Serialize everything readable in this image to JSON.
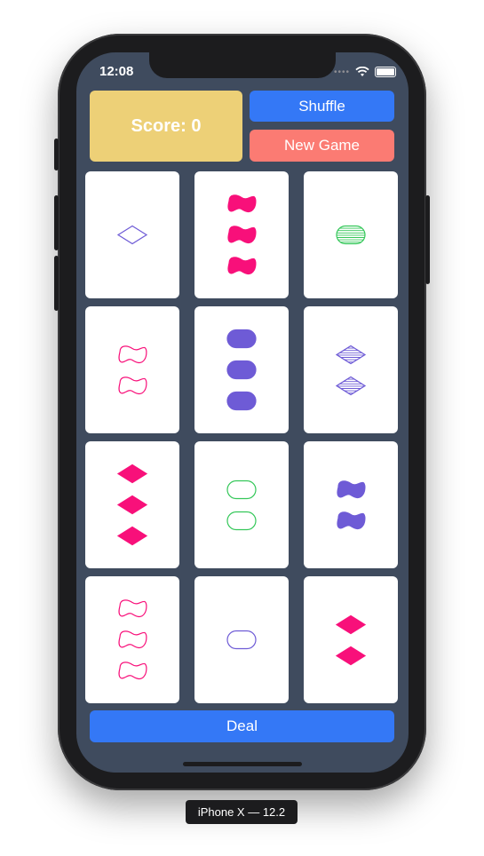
{
  "status_bar": {
    "time": "12:08"
  },
  "header": {
    "score_label": "Score: 0",
    "shuffle_label": "Shuffle",
    "new_game_label": "New Game"
  },
  "footer": {
    "deal_label": "Deal"
  },
  "device_caption": "iPhone X — 12.2",
  "colors": {
    "purple": "#6e5bd6",
    "pink": "#f8107a",
    "green": "#34c759",
    "blue_button": "#3478f6",
    "salmon_button": "#fb7b73",
    "score_yellow": "#edd077",
    "table": "#3f4b5e"
  },
  "cards": [
    {
      "count": 1,
      "shape": "diamond",
      "color": "purple",
      "shading": "open"
    },
    {
      "count": 3,
      "shape": "squiggle",
      "color": "pink",
      "shading": "solid"
    },
    {
      "count": 1,
      "shape": "oval",
      "color": "green",
      "shading": "striped"
    },
    {
      "count": 2,
      "shape": "squiggle",
      "color": "pink",
      "shading": "open"
    },
    {
      "count": 3,
      "shape": "oval",
      "color": "purple",
      "shading": "solid"
    },
    {
      "count": 2,
      "shape": "diamond",
      "color": "purple",
      "shading": "striped"
    },
    {
      "count": 3,
      "shape": "diamond",
      "color": "pink",
      "shading": "solid"
    },
    {
      "count": 2,
      "shape": "oval",
      "color": "green",
      "shading": "open"
    },
    {
      "count": 2,
      "shape": "squiggle",
      "color": "purple",
      "shading": "solid"
    },
    {
      "count": 3,
      "shape": "squiggle",
      "color": "pink",
      "shading": "open"
    },
    {
      "count": 1,
      "shape": "oval",
      "color": "purple",
      "shading": "open"
    },
    {
      "count": 2,
      "shape": "diamond",
      "color": "pink",
      "shading": "solid"
    }
  ]
}
